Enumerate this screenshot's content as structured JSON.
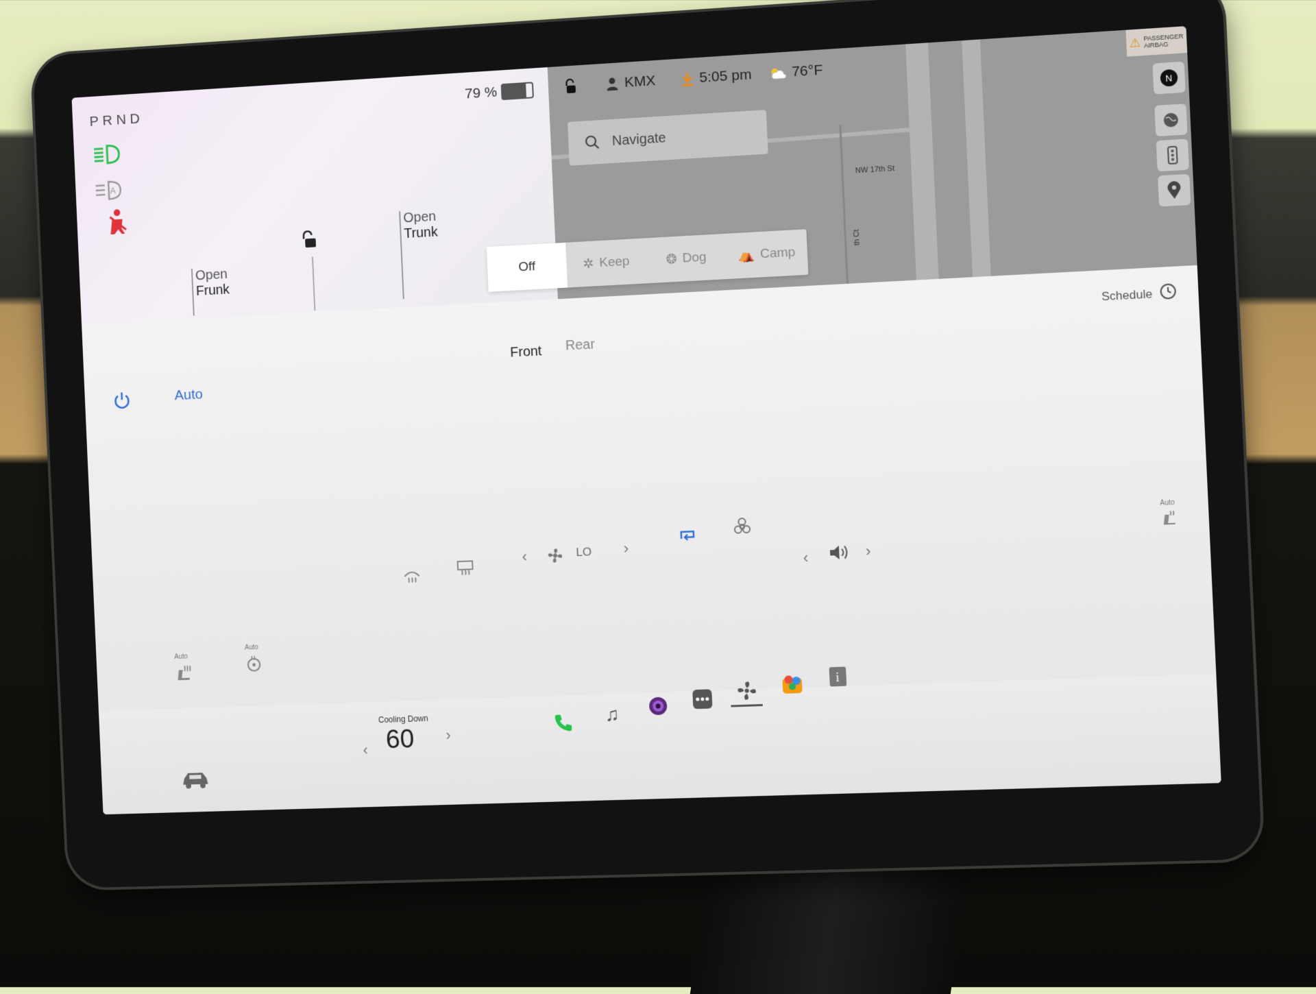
{
  "status": {
    "gear": "PRND",
    "battery_percent": "79 %",
    "battery_level": 0.79,
    "user": "KMX",
    "time": "5:05 pm",
    "weather": "76°F"
  },
  "map": {
    "search_placeholder": "Navigate",
    "street_1": "NW 17th St",
    "street_2": "th Ct",
    "airbag_text": "PASSENGER AIRBAG"
  },
  "vehicle": {
    "frunk_label_1": "Open",
    "frunk_label_2": "Frunk",
    "trunk_label_1": "Open",
    "trunk_label_2": "Trunk"
  },
  "climate_modes": [
    {
      "label": "Off",
      "selected": true
    },
    {
      "label": "Keep",
      "selected": false
    },
    {
      "label": "Dog",
      "selected": false
    },
    {
      "label": "Camp",
      "selected": false
    }
  ],
  "climate": {
    "auto_label": "Auto",
    "front_tab": "Front",
    "rear_tab": "Rear",
    "schedule_label": "Schedule",
    "fan_level": "LO",
    "seat_auto_left": "Auto",
    "seat_auto_right": "Auto",
    "steering_auto": "Auto"
  },
  "dock": {
    "temp_status": "Cooling Down",
    "temp_value": "60"
  },
  "colors": {
    "accent_blue": "#2f6fd6",
    "headlight_green": "#2bbf52",
    "seatbelt_red": "#e0323a",
    "phone_green": "#26c24a",
    "download_orange": "#e88a1a"
  }
}
